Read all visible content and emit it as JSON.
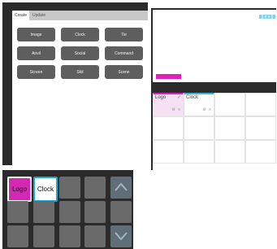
{
  "editor": {
    "tabs": [
      {
        "label": "Create"
      },
      {
        "label": "Update"
      }
    ],
    "buttons": [
      {
        "label": "Image"
      },
      {
        "label": "Clock"
      },
      {
        "label": "Tie"
      },
      {
        "label": "Anvil"
      },
      {
        "label": "Social"
      },
      {
        "label": "Command"
      },
      {
        "label": "Screen"
      },
      {
        "label": "Skit"
      },
      {
        "label": "Scene"
      }
    ]
  },
  "grid": {
    "cells": [
      {
        "label": "Logo"
      },
      {
        "label": "Clock"
      }
    ]
  },
  "keypad": {
    "keys": [
      {
        "label": "Logo"
      },
      {
        "label": "Clock"
      }
    ],
    "nav_icons": [
      "chevron-up-icon",
      "chevron-down-icon"
    ]
  },
  "colors": {
    "panel": "#2b2b2b",
    "button": "#5e5e5e",
    "magenta": "#e020b8",
    "cyan": "#3fb4d6"
  }
}
